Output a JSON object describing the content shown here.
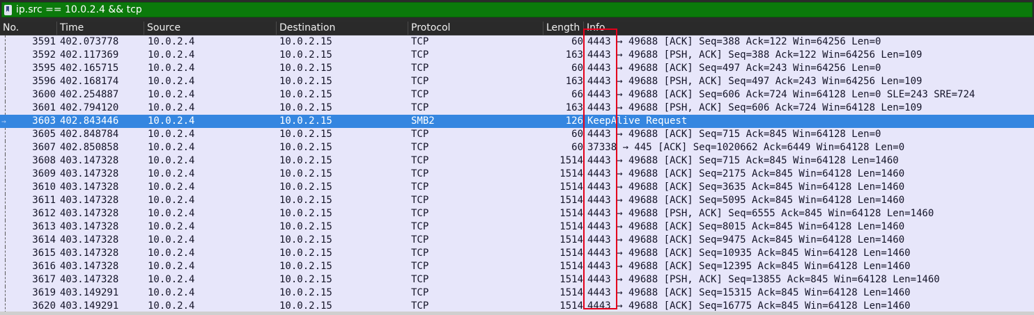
{
  "filter": {
    "value": "ip.src == 10.0.2.4 && tcp"
  },
  "columns": [
    "No.",
    "Time",
    "Source",
    "Destination",
    "Protocol",
    "Length",
    "Info"
  ],
  "packets": [
    {
      "no": "3591",
      "time": "402.073778",
      "src": "10.0.2.4",
      "dst": "10.0.2.15",
      "proto": "TCP",
      "len": "60",
      "info": "4443 → 49688 [ACK] Seq=388 Ack=122 Win=64256 Len=0"
    },
    {
      "no": "3592",
      "time": "402.117369",
      "src": "10.0.2.4",
      "dst": "10.0.2.15",
      "proto": "TCP",
      "len": "163",
      "info": "4443 → 49688 [PSH, ACK] Seq=388 Ack=122 Win=64256 Len=109"
    },
    {
      "no": "3595",
      "time": "402.165715",
      "src": "10.0.2.4",
      "dst": "10.0.2.15",
      "proto": "TCP",
      "len": "60",
      "info": "4443 → 49688 [ACK] Seq=497 Ack=243 Win=64256 Len=0"
    },
    {
      "no": "3596",
      "time": "402.168174",
      "src": "10.0.2.4",
      "dst": "10.0.2.15",
      "proto": "TCP",
      "len": "163",
      "info": "4443 → 49688 [PSH, ACK] Seq=497 Ack=243 Win=64256 Len=109"
    },
    {
      "no": "3600",
      "time": "402.254887",
      "src": "10.0.2.4",
      "dst": "10.0.2.15",
      "proto": "TCP",
      "len": "66",
      "info": "4443 → 49688 [ACK] Seq=606 Ack=724 Win=64128 Len=0 SLE=243 SRE=724"
    },
    {
      "no": "3601",
      "time": "402.794120",
      "src": "10.0.2.4",
      "dst": "10.0.2.15",
      "proto": "TCP",
      "len": "163",
      "info": "4443 → 49688 [PSH, ACK] Seq=606 Ack=724 Win=64128 Len=109"
    },
    {
      "no": "3603",
      "time": "402.843446",
      "src": "10.0.2.4",
      "dst": "10.0.2.15",
      "proto": "SMB2",
      "len": "126",
      "info": "KeepAlive Request",
      "selected": true
    },
    {
      "no": "3605",
      "time": "402.848784",
      "src": "10.0.2.4",
      "dst": "10.0.2.15",
      "proto": "TCP",
      "len": "60",
      "info": "4443 → 49688 [ACK] Seq=715 Ack=845 Win=64128 Len=0"
    },
    {
      "no": "3607",
      "time": "402.850858",
      "src": "10.0.2.4",
      "dst": "10.0.2.15",
      "proto": "TCP",
      "len": "60",
      "info": "37338 → 445 [ACK] Seq=1020662 Ack=6449 Win=64128 Len=0"
    },
    {
      "no": "3608",
      "time": "403.147328",
      "src": "10.0.2.4",
      "dst": "10.0.2.15",
      "proto": "TCP",
      "len": "1514",
      "info": "4443 → 49688 [ACK] Seq=715 Ack=845 Win=64128 Len=1460"
    },
    {
      "no": "3609",
      "time": "403.147328",
      "src": "10.0.2.4",
      "dst": "10.0.2.15",
      "proto": "TCP",
      "len": "1514",
      "info": "4443 → 49688 [ACK] Seq=2175 Ack=845 Win=64128 Len=1460"
    },
    {
      "no": "3610",
      "time": "403.147328",
      "src": "10.0.2.4",
      "dst": "10.0.2.15",
      "proto": "TCP",
      "len": "1514",
      "info": "4443 → 49688 [ACK] Seq=3635 Ack=845 Win=64128 Len=1460"
    },
    {
      "no": "3611",
      "time": "403.147328",
      "src": "10.0.2.4",
      "dst": "10.0.2.15",
      "proto": "TCP",
      "len": "1514",
      "info": "4443 → 49688 [ACK] Seq=5095 Ack=845 Win=64128 Len=1460"
    },
    {
      "no": "3612",
      "time": "403.147328",
      "src": "10.0.2.4",
      "dst": "10.0.2.15",
      "proto": "TCP",
      "len": "1514",
      "info": "4443 → 49688 [PSH, ACK] Seq=6555 Ack=845 Win=64128 Len=1460"
    },
    {
      "no": "3613",
      "time": "403.147328",
      "src": "10.0.2.4",
      "dst": "10.0.2.15",
      "proto": "TCP",
      "len": "1514",
      "info": "4443 → 49688 [ACK] Seq=8015 Ack=845 Win=64128 Len=1460"
    },
    {
      "no": "3614",
      "time": "403.147328",
      "src": "10.0.2.4",
      "dst": "10.0.2.15",
      "proto": "TCP",
      "len": "1514",
      "info": "4443 → 49688 [ACK] Seq=9475 Ack=845 Win=64128 Len=1460"
    },
    {
      "no": "3615",
      "time": "403.147328",
      "src": "10.0.2.4",
      "dst": "10.0.2.15",
      "proto": "TCP",
      "len": "1514",
      "info": "4443 → 49688 [ACK] Seq=10935 Ack=845 Win=64128 Len=1460"
    },
    {
      "no": "3616",
      "time": "403.147328",
      "src": "10.0.2.4",
      "dst": "10.0.2.15",
      "proto": "TCP",
      "len": "1514",
      "info": "4443 → 49688 [ACK] Seq=12395 Ack=845 Win=64128 Len=1460"
    },
    {
      "no": "3617",
      "time": "403.147328",
      "src": "10.0.2.4",
      "dst": "10.0.2.15",
      "proto": "TCP",
      "len": "1514",
      "info": "4443 → 49688 [PSH, ACK] Seq=13855 Ack=845 Win=64128 Len=1460"
    },
    {
      "no": "3619",
      "time": "403.149291",
      "src": "10.0.2.4",
      "dst": "10.0.2.15",
      "proto": "TCP",
      "len": "1514",
      "info": "4443 → 49688 [ACK] Seq=15315 Ack=845 Win=64128 Len=1460"
    },
    {
      "no": "3620",
      "time": "403.149291",
      "src": "10.0.2.4",
      "dst": "10.0.2.15",
      "proto": "TCP",
      "len": "1514",
      "info": "4443 → 49688 [ACK] Seq=16775 Ack=845 Win=64128 Len=1460"
    }
  ],
  "colors": {
    "filter_valid": "#0b7a0b",
    "row_bg": "#e7e6fa",
    "selected_row": "#3586e0",
    "highlight_box": "#e3001b"
  }
}
